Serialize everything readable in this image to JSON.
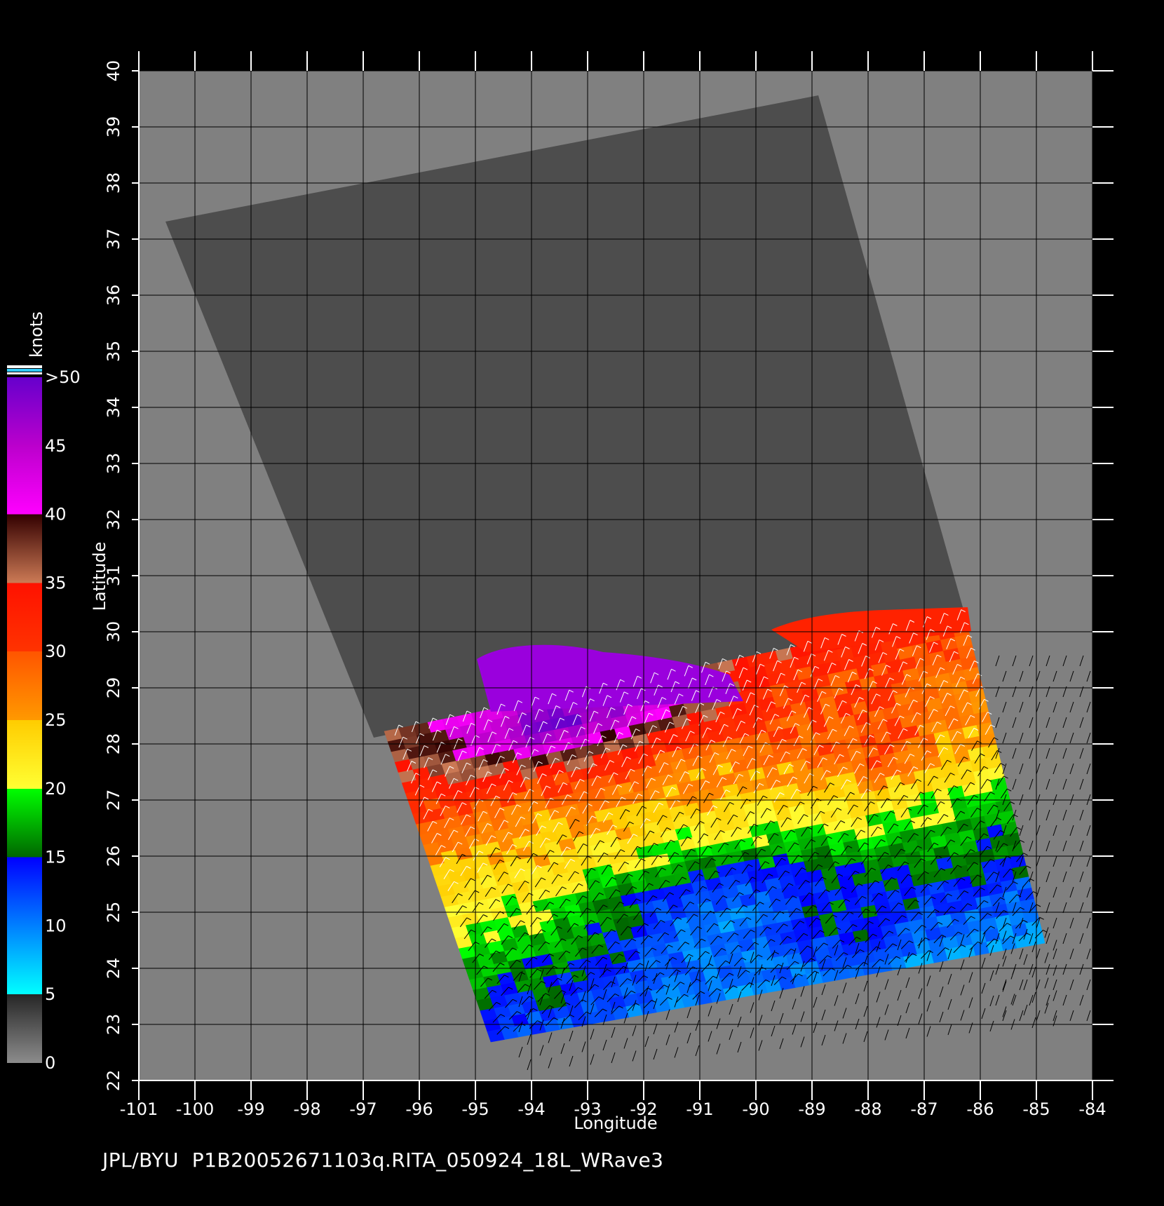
{
  "map": {
    "lon_range": [
      -101,
      -84
    ],
    "lat_range": [
      22,
      40
    ],
    "lon_ticks": [
      "-101",
      "-100",
      "-99",
      "-98",
      "-97",
      "-96",
      "-95",
      "-94",
      "-93",
      "-92",
      "-91",
      "-90",
      "-89",
      "-88",
      "-87",
      "-86",
      "-85",
      "-84"
    ],
    "lat_ticks": [
      "22",
      "23",
      "24",
      "25",
      "26",
      "27",
      "28",
      "29",
      "30",
      "31",
      "32",
      "33",
      "34",
      "35",
      "36",
      "37",
      "38",
      "39",
      "40"
    ],
    "xlabel": "Longitude",
    "ylabel": "Latitude",
    "grid": true,
    "colors": {
      "background": "#000000",
      "land": "#808080",
      "swath": "#4d4d4d",
      "grid": "#000000",
      "axis": "#ffffff",
      "barb_high": "#ffffff",
      "barb_low": "#000000"
    }
  },
  "colorbar": {
    "unit": "knots",
    "labels": [
      ">50",
      "45",
      "40",
      "35",
      "30",
      "25",
      "20",
      "15",
      "10",
      "5",
      "0"
    ],
    "stops": [
      {
        "knots": 0,
        "color": "#8c8c8c"
      },
      {
        "knots": 5,
        "color": "#262626"
      },
      {
        "knots": 5,
        "color": "#00ffff"
      },
      {
        "knots": 15,
        "color": "#0000ff"
      },
      {
        "knots": 15,
        "color": "#006600"
      },
      {
        "knots": 20,
        "color": "#00ff00"
      },
      {
        "knots": 20,
        "color": "#ffff33"
      },
      {
        "knots": 25,
        "color": "#ffcc00"
      },
      {
        "knots": 25,
        "color": "#ff9900"
      },
      {
        "knots": 30,
        "color": "#ff5500"
      },
      {
        "knots": 30,
        "color": "#ff3300"
      },
      {
        "knots": 35,
        "color": "#ff1100"
      },
      {
        "knots": 35,
        "color": "#cc7a55"
      },
      {
        "knots": 40,
        "color": "#330000"
      },
      {
        "knots": 40,
        "color": "#ff00ff"
      },
      {
        "knots": 45,
        "color": "#bb00cc"
      },
      {
        "knots": 50,
        "color": "#6600cc"
      }
    ],
    "top_bands": [
      "#ffffff",
      "#33ccff",
      "#ffffff"
    ]
  },
  "footer": {
    "title": "JPL/BYU  P1B20052671103q.RITA_050924_18L_WRave3"
  }
}
